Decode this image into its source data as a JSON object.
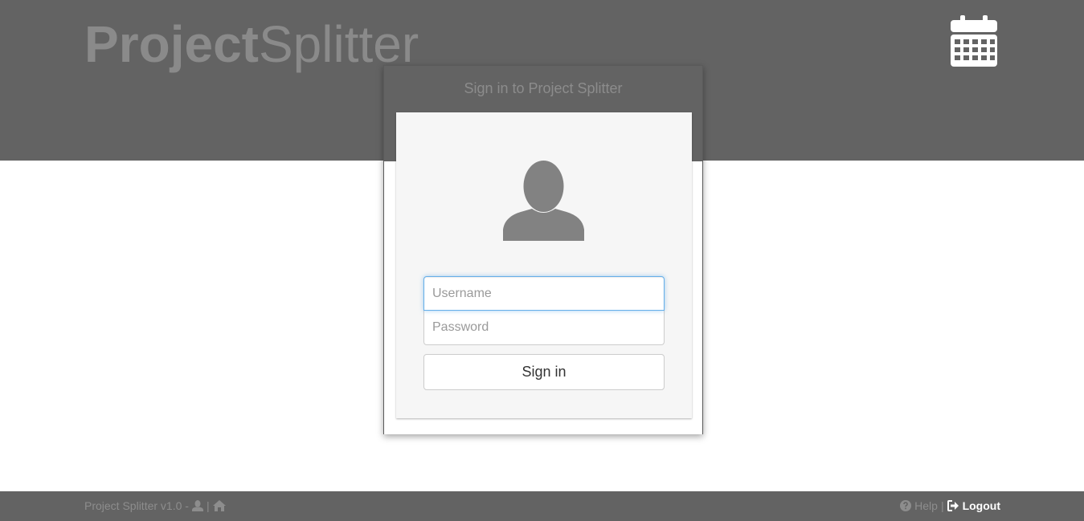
{
  "header": {
    "logo_bold": "Project",
    "logo_light": "Splitter",
    "calendar_icon": "calendar-icon"
  },
  "login_modal": {
    "title": "Sign in to Project Splitter",
    "avatar_icon": "user-silhouette-icon",
    "username_placeholder": "Username",
    "username_value": "",
    "password_placeholder": "Password",
    "password_value": "",
    "signin_label": "Sign in"
  },
  "footer": {
    "version_text": "Project Splitter v1.0 -",
    "separator": "|",
    "user_icon": "user-icon",
    "home_icon": "home-icon",
    "help_icon": "question-circle-icon",
    "help_label": "Help",
    "logout_icon": "logout-icon",
    "logout_label": "Logout"
  },
  "colors": {
    "header_bg": "#636363",
    "footer_bg": "#636363",
    "logo_text": "#8a8a8a",
    "card_bg": "#f6f6f6",
    "focus_border": "#66afe9"
  }
}
